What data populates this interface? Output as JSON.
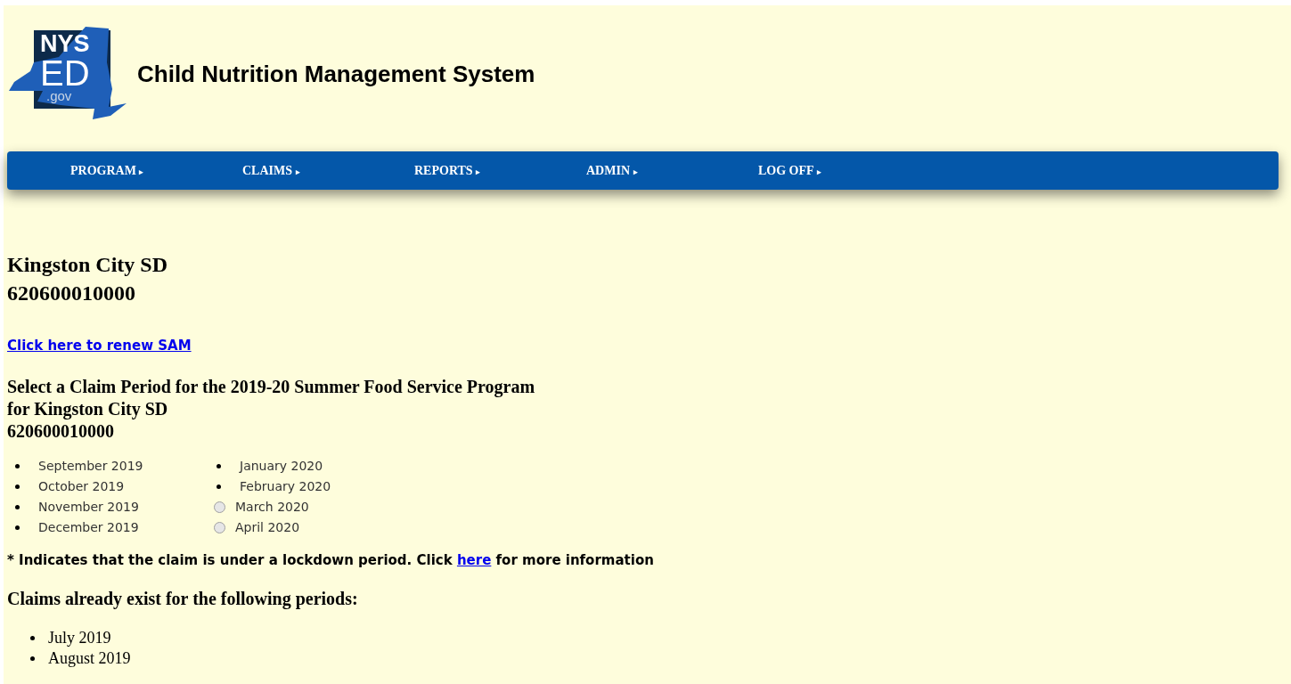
{
  "logo": {
    "line_1": "NYS",
    "line_2": "ED",
    "line_3": ".gov"
  },
  "site_title": "Child Nutrition Management System",
  "menu": [
    {
      "label": "PROGRAM",
      "arrow": "▸"
    },
    {
      "label": "CLAIMS",
      "arrow": "▸"
    },
    {
      "label": "REPORTS",
      "arrow": "▸"
    },
    {
      "label": "ADMIN",
      "arrow": "▸"
    },
    {
      "label": "LOG OFF",
      "arrow": "▸"
    }
  ],
  "sponsor": {
    "name": "Kingston City SD",
    "code": "620600010000"
  },
  "renew_link": "Click here to renew SAM",
  "select_heading": [
    "Select a Claim Period for the 2019-20 Summer Food Service Program",
    "for Kingston City SD",
    "620600010000"
  ],
  "period_columns": [
    [
      {
        "kind": "bullet",
        "label": "September 2019"
      },
      {
        "kind": "bullet",
        "label": "October 2019"
      },
      {
        "kind": "bullet",
        "label": "November 2019"
      },
      {
        "kind": "bullet",
        "label": "December 2019"
      }
    ],
    [
      {
        "kind": "bullet",
        "label": "January 2020"
      },
      {
        "kind": "bullet",
        "label": "February 2020"
      },
      {
        "kind": "radio",
        "label": "March 2020",
        "selected": false
      },
      {
        "kind": "radio",
        "label": "April 2020",
        "selected": false
      }
    ]
  ],
  "lockdown_note": {
    "before": "* Indicates that the claim is under a lockdown period. Click",
    "link": "here",
    "after": "for more information"
  },
  "existing_heading": "Claims already exist for the following periods:",
  "existing_claims": [
    "July 2019",
    "August 2019"
  ]
}
